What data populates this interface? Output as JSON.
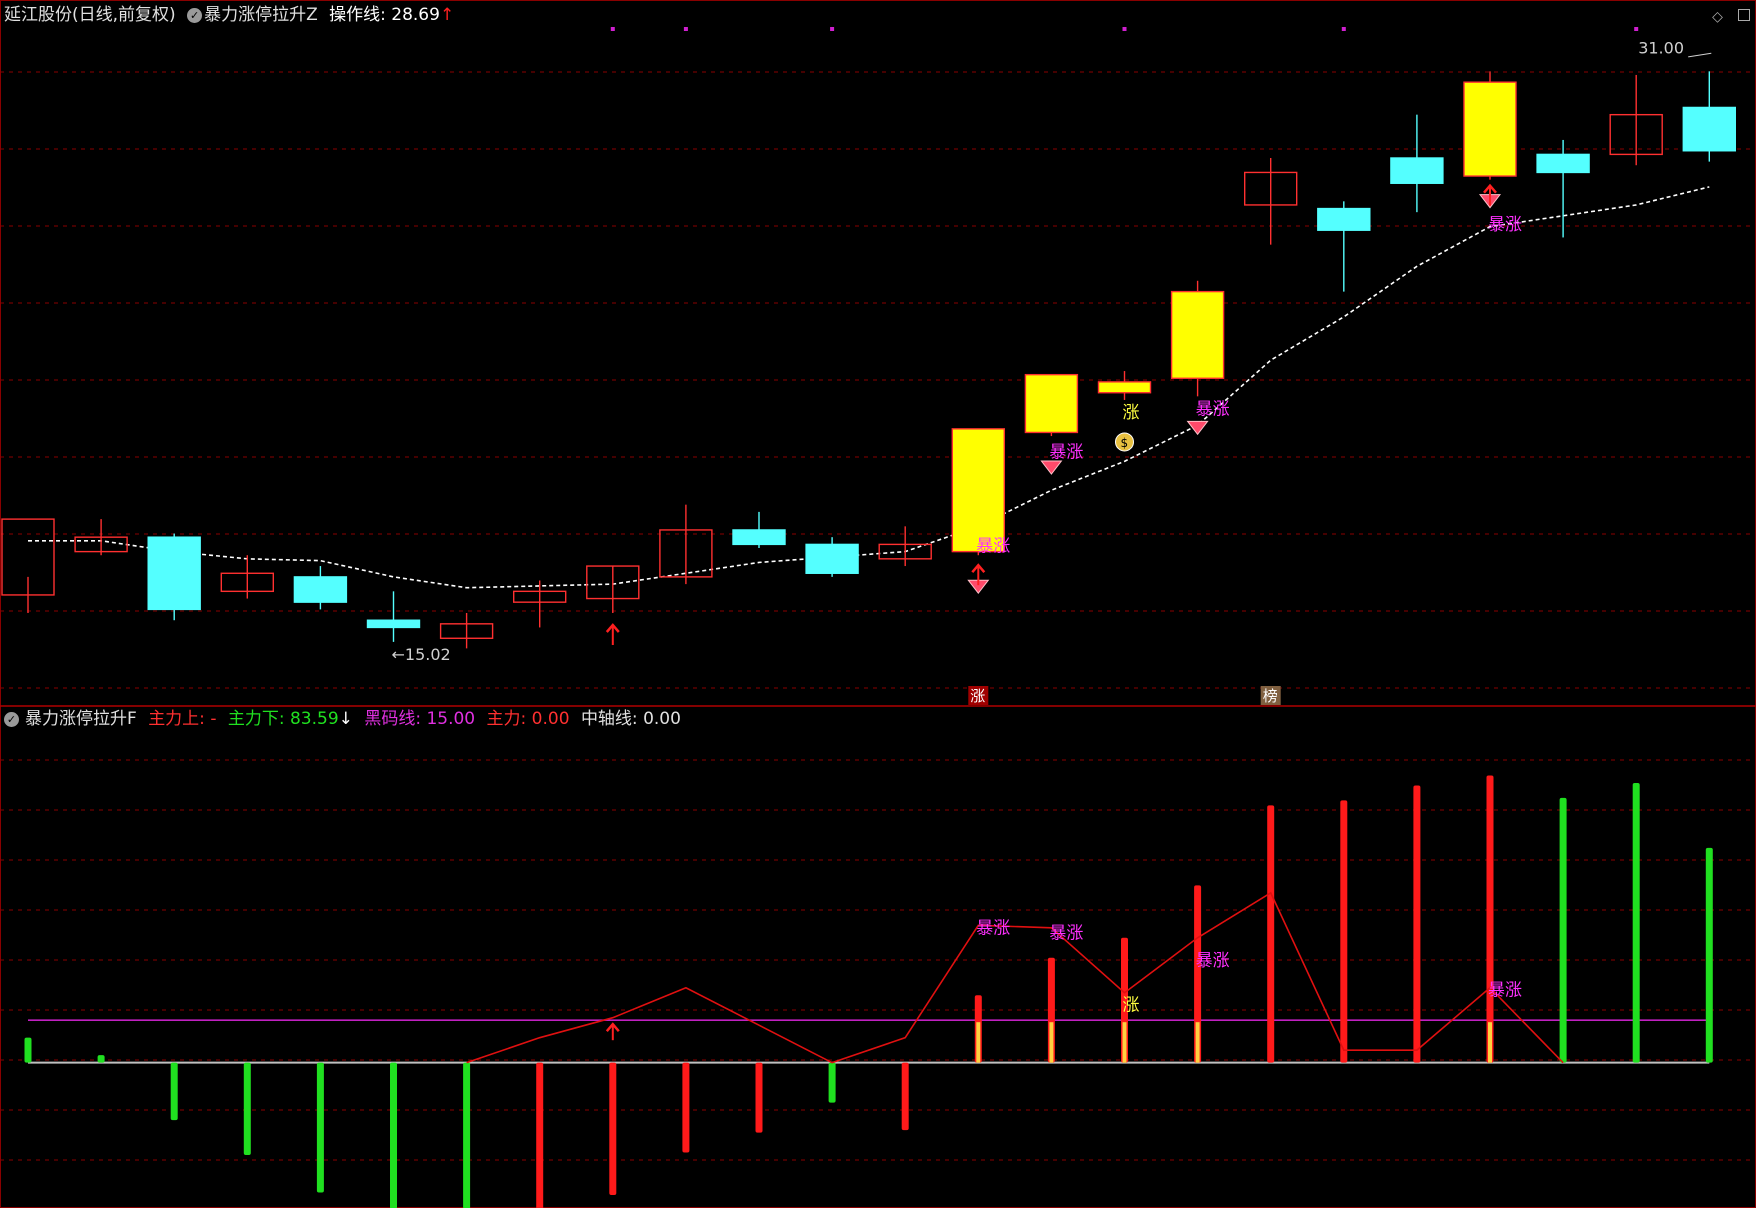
{
  "header": {
    "stock_title": "延江股份(日线,前复权)",
    "indicator_name": "暴力涨停拉升Z",
    "op_line_label": "操作线: 28.69",
    "op_line_arrow": "↑"
  },
  "sub_header": {
    "indicator_name": "暴力涨停拉升F",
    "main_up_label": "主力上: -",
    "main_down_label": "主力下: 83.59",
    "main_down_arrow": "↓",
    "black_line_label": "黑码线: 15.00",
    "main_label": "主力: 0.00",
    "axis_label": "中轴线: 0.00"
  },
  "colors": {
    "up": "#ff3030",
    "down_fill": "#54ffff",
    "limit_fill": "#ffff00",
    "grid": "#8a0000",
    "ma": "#ffffff",
    "purple_line": "#c020c0",
    "baseline": "#c0c0c0",
    "green_bar": "#20e020",
    "red_bar": "#ff1a1a",
    "tag_text": "#ff30ff",
    "zhang_text": "#ffff40"
  },
  "chart_data": [
    {
      "type": "candlestick",
      "ylim": [
        14.2,
        32.2
      ],
      "candles": [
        {
          "o": 16.5,
          "h": 17.0,
          "l": 16.0,
          "c": 18.6,
          "kind": "up"
        },
        {
          "o": 17.7,
          "h": 18.6,
          "l": 17.6,
          "c": 18.1,
          "kind": "up"
        },
        {
          "o": 18.1,
          "h": 18.2,
          "l": 15.8,
          "c": 16.1,
          "kind": "down"
        },
        {
          "o": 16.6,
          "h": 17.6,
          "l": 16.4,
          "c": 17.1,
          "kind": "up"
        },
        {
          "o": 17.0,
          "h": 17.3,
          "l": 16.1,
          "c": 16.3,
          "kind": "down"
        },
        {
          "o": 15.8,
          "h": 16.6,
          "l": 15.2,
          "c": 15.6,
          "kind": "down"
        },
        {
          "o": 15.3,
          "h": 16.0,
          "l": 15.02,
          "c": 15.7,
          "kind": "up"
        },
        {
          "o": 16.3,
          "h": 16.9,
          "l": 15.6,
          "c": 16.6,
          "kind": "up"
        },
        {
          "o": 16.4,
          "h": 17.3,
          "l": 16.0,
          "c": 17.3,
          "kind": "up"
        },
        {
          "o": 17.0,
          "h": 19.0,
          "l": 16.8,
          "c": 18.3,
          "kind": "up"
        },
        {
          "o": 18.3,
          "h": 18.8,
          "l": 17.8,
          "c": 17.9,
          "kind": "down"
        },
        {
          "o": 17.9,
          "h": 18.1,
          "l": 17.0,
          "c": 17.1,
          "kind": "down"
        },
        {
          "o": 17.5,
          "h": 18.4,
          "l": 17.3,
          "c": 17.9,
          "kind": "up"
        },
        {
          "o": 17.7,
          "h": 21.1,
          "l": 17.6,
          "c": 21.1,
          "kind": "limit"
        },
        {
          "o": 21.0,
          "h": 22.5,
          "l": 20.9,
          "c": 22.6,
          "kind": "limit"
        },
        {
          "o": 22.4,
          "h": 22.7,
          "l": 21.9,
          "c": 22.1,
          "kind": "limit"
        },
        {
          "o": 22.5,
          "h": 25.2,
          "l": 22.0,
          "c": 24.9,
          "kind": "limit"
        },
        {
          "o": 27.3,
          "h": 28.6,
          "l": 26.2,
          "c": 28.2,
          "kind": "up"
        },
        {
          "o": 27.2,
          "h": 27.4,
          "l": 24.9,
          "c": 26.6,
          "kind": "down"
        },
        {
          "o": 28.6,
          "h": 29.8,
          "l": 27.1,
          "c": 27.9,
          "kind": "down"
        },
        {
          "o": 28.1,
          "h": 31.0,
          "l": 28.0,
          "c": 30.7,
          "kind": "limit"
        },
        {
          "o": 28.7,
          "h": 29.1,
          "l": 26.4,
          "c": 28.2,
          "kind": "down"
        },
        {
          "o": 28.7,
          "h": 30.9,
          "l": 28.4,
          "c": 29.8,
          "kind": "up"
        },
        {
          "o": 30.0,
          "h": 31.0,
          "l": 28.5,
          "c": 28.8,
          "kind": "down"
        }
      ],
      "ma": [
        18.0,
        18.0,
        17.7,
        17.5,
        17.45,
        17.0,
        16.7,
        16.75,
        16.8,
        17.1,
        17.4,
        17.55,
        17.7,
        18.4,
        19.4,
        20.2,
        21.2,
        23.0,
        24.2,
        25.6,
        26.7,
        27.0,
        27.3,
        27.8
      ],
      "low_label": "←15.02",
      "high_label": "31.00",
      "tags": [
        {
          "i": 13,
          "text": "暴涨",
          "y": 17.7
        },
        {
          "i": 14,
          "text": "暴涨",
          "y": 20.3
        },
        {
          "i": 15,
          "text": "涨",
          "y": 21.4
        },
        {
          "i": 16,
          "text": "暴涨",
          "y": 21.5
        },
        {
          "i": 20,
          "text": "暴涨",
          "y": 26.6
        }
      ],
      "diamonds": [
        13,
        14,
        16,
        20
      ],
      "moneybag": 15,
      "up_arrows": [
        8,
        13,
        20
      ],
      "bottom_markers": [
        {
          "i": 13,
          "text": "涨"
        },
        {
          "i": 17,
          "text": "榜"
        }
      ],
      "top_dots": [
        8,
        9,
        11,
        15,
        18,
        22
      ]
    },
    {
      "type": "bar",
      "ylim": [
        -57,
        130
      ],
      "values": [
        10,
        3,
        -23,
        -37,
        -52,
        -62,
        -68,
        -62,
        -53,
        -36,
        -28,
        -16,
        -27,
        27,
        42,
        50,
        71,
        103,
        105,
        111,
        115,
        106,
        112,
        86
      ],
      "bar_colors": [
        "green",
        "green",
        "green",
        "green",
        "green",
        "green",
        "green",
        "red",
        "red",
        "red",
        "red",
        "green",
        "red",
        "red",
        "red",
        "red",
        "red",
        "red",
        "red",
        "red",
        "red",
        "green",
        "green",
        "green"
      ],
      "line": [
        null,
        null,
        null,
        null,
        null,
        null,
        0,
        10,
        18,
        30,
        15,
        0,
        10,
        55,
        54,
        28,
        50,
        68,
        5,
        5,
        30,
        0,
        null,
        null
      ],
      "purple_level": 17,
      "tags": [
        {
          "i": 13,
          "text": "暴涨",
          "y": 55
        },
        {
          "i": 14,
          "text": "暴涨",
          "y": 53
        },
        {
          "i": 15,
          "text": "涨",
          "y": 24
        },
        {
          "i": 16,
          "text": "暴涨",
          "y": 42
        },
        {
          "i": 20,
          "text": "暴涨",
          "y": 30
        }
      ],
      "up_arrows": [
        8
      ],
      "yellow_markers": [
        13,
        14,
        15,
        16,
        20
      ]
    }
  ]
}
